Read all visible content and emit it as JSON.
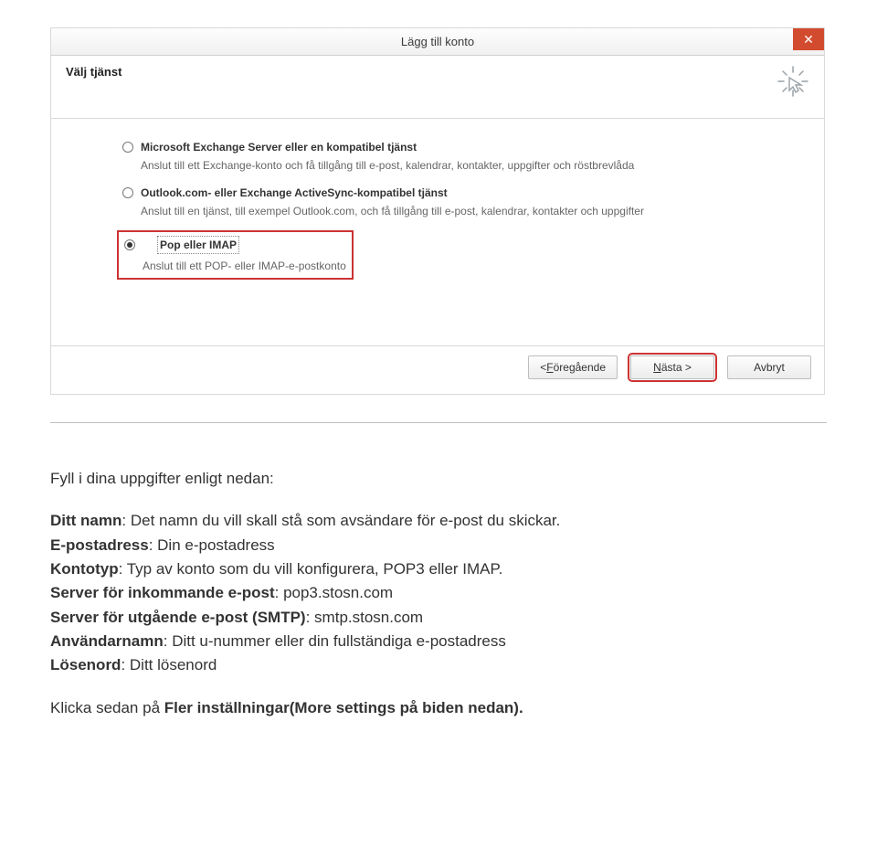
{
  "dialog": {
    "title": "Lägg till konto",
    "heading": "Välj tjänst",
    "options": [
      {
        "label": "Microsoft Exchange Server eller en kompatibel tjänst",
        "desc": "Anslut till ett Exchange-konto och få tillgång till e-post, kalendrar, kontakter, uppgifter och röstbrevlåda"
      },
      {
        "label": "Outlook.com- eller Exchange ActiveSync-kompatibel tjänst",
        "desc": "Anslut till en tjänst, till exempel Outlook.com, och få tillgång till e-post, kalendrar, kontakter och uppgifter"
      },
      {
        "label": "Pop eller IMAP",
        "desc": "Anslut till ett POP- eller IMAP-e-postkonto"
      }
    ],
    "buttons": {
      "back_lt": "< ",
      "back_u": "F",
      "back_rest": "öregående",
      "next_u": "N",
      "next_rest": "ästa >",
      "cancel": "Avbryt"
    }
  },
  "instr": {
    "intro": "Fyll i dina uppgifter enligt nedan:",
    "l1_b": "Ditt namn",
    "l1_r": ": Det namn du vill skall stå som avsändare för e-post du skickar.",
    "l2_b": "E-postadress",
    "l2_r": ": Din e-postadress",
    "l3_b": "Kontotyp",
    "l3_r": ": Typ av konto som du vill konfigurera, POP3 eller IMAP.",
    "l4_b": "Server för inkommande e-post",
    "l4_r": ": pop3.stosn.com",
    "l5_b": "Server för utgående e-post (SMTP)",
    "l5_r": ": smtp.stosn.com",
    "l6_b": "Användarnamn",
    "l6_r": ": Ditt u-nummer eller din fullständiga e-postadress",
    "l7_b": "Lösenord",
    "l7_r": ": Ditt lösenord",
    "footer_a": "Klicka sedan på ",
    "footer_b": "Fler inställningar(More settings på biden nedan)."
  }
}
